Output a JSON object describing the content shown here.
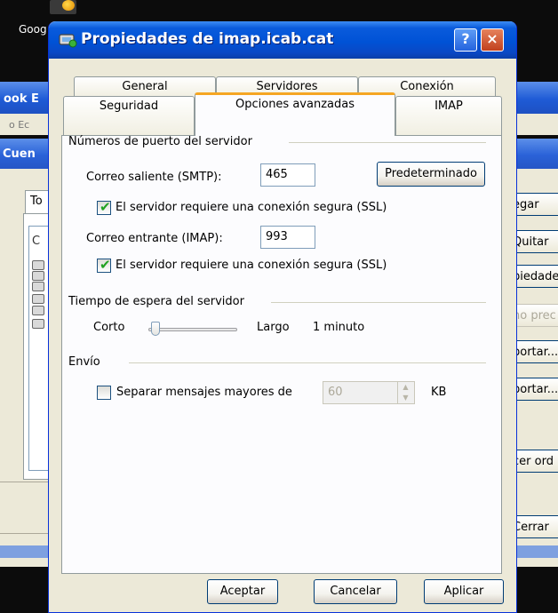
{
  "background": {
    "top_window_label": "Goog",
    "main_title_fragment": "ook E",
    "menu_fragment": "o   Ec",
    "accounts_title_fragment": "Cuen",
    "tab_fragment": "To",
    "column_fragment": "C",
    "side_buttons": [
      "egar",
      "Quitar",
      "piedade",
      "no prec",
      "portar...",
      "portar...",
      "cer ord",
      "Cerrar"
    ]
  },
  "dialog": {
    "title": "Propiedades de imap.icab.cat",
    "help_label": "?",
    "close_label": "×",
    "tabs_back": [
      "General",
      "Servidores",
      "Conexión"
    ],
    "tabs_front": [
      "Seguridad",
      "Opciones avanzadas",
      "IMAP"
    ],
    "ports_group": "Números de puerto del servidor",
    "smtp_label": "Correo saliente (SMTP):",
    "smtp_value": "465",
    "default_button": "Predeterminado",
    "ssl_label_1": "El servidor requiere una conexión segura (SSL)",
    "imap_label": "Correo entrante (IMAP):",
    "imap_value": "993",
    "ssl_label_2": "El servidor requiere una conexión segura (SSL)",
    "timeout_group": "Tiempo de espera del servidor",
    "short_label": "Corto",
    "long_label": "Largo",
    "timeout_value": "1 minuto",
    "timeout_level": 0.05,
    "send_group": "Envío",
    "split_label": "Separar mensajes mayores de",
    "split_value": "60",
    "kb_label": "KB",
    "ok_button": "Aceptar",
    "cancel_button": "Cancelar",
    "apply_button": "Aplicar",
    "accent_color": "#0052d6",
    "tab_highlight_color": "#f5a623"
  }
}
